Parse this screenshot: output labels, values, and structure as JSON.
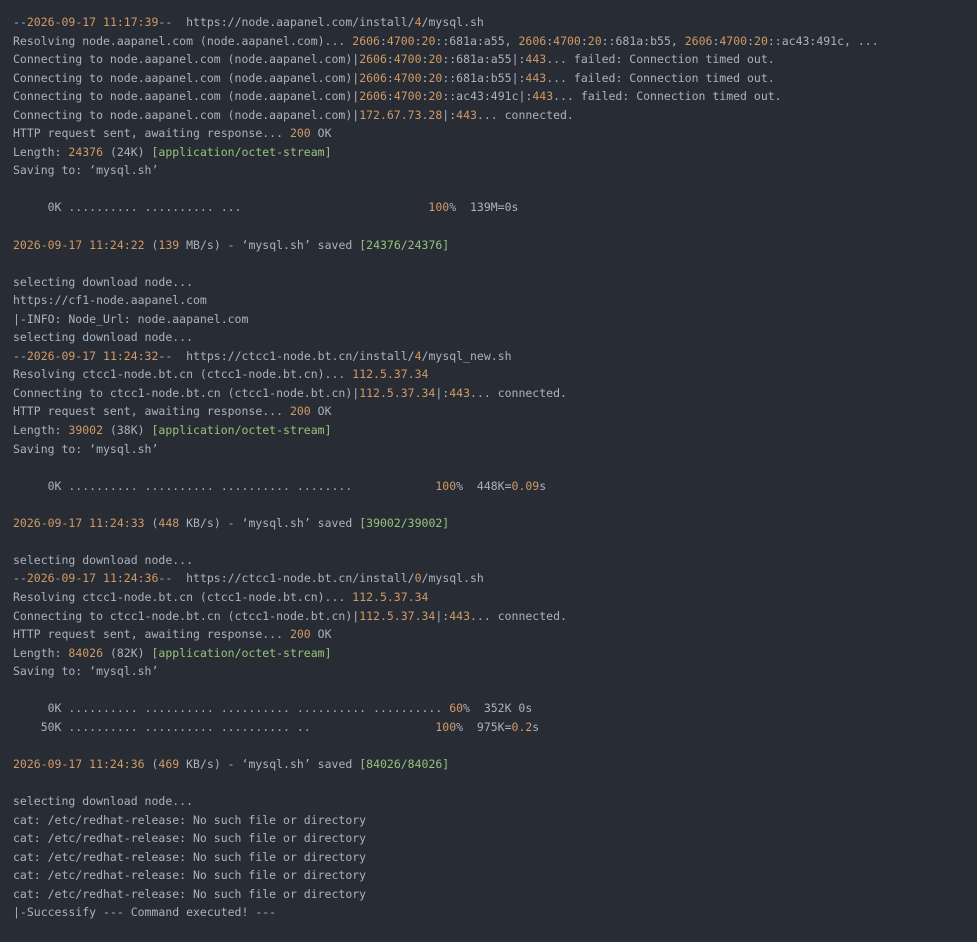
{
  "theme": {
    "background": "#282c34",
    "foreground": "#abb2bf",
    "number_color": "#d19a66",
    "string_color": "#98c379"
  },
  "terminal": {
    "lines": [
      [
        {
          "t": "--",
          "c": "d"
        },
        {
          "t": "2026-09-17 11:17:39",
          "c": "o"
        },
        {
          "t": "--  https://node.aapanel.com/install/",
          "c": "d"
        },
        {
          "t": "4",
          "c": "o"
        },
        {
          "t": "/mysql.sh",
          "c": "d"
        }
      ],
      [
        {
          "t": "Resolving node.aapanel.com (node.aapanel.com)... ",
          "c": "d"
        },
        {
          "t": "2606",
          "c": "o"
        },
        {
          "t": ":",
          "c": "d"
        },
        {
          "t": "4700",
          "c": "o"
        },
        {
          "t": ":",
          "c": "d"
        },
        {
          "t": "20",
          "c": "o"
        },
        {
          "t": "::681a:a55, ",
          "c": "d"
        },
        {
          "t": "2606",
          "c": "o"
        },
        {
          "t": ":",
          "c": "d"
        },
        {
          "t": "4700",
          "c": "o"
        },
        {
          "t": ":",
          "c": "d"
        },
        {
          "t": "20",
          "c": "o"
        },
        {
          "t": "::681a:b55, ",
          "c": "d"
        },
        {
          "t": "2606",
          "c": "o"
        },
        {
          "t": ":",
          "c": "d"
        },
        {
          "t": "4700",
          "c": "o"
        },
        {
          "t": ":",
          "c": "d"
        },
        {
          "t": "20",
          "c": "o"
        },
        {
          "t": "::ac43:491c, ...",
          "c": "d"
        }
      ],
      [
        {
          "t": "Connecting to node.aapanel.com (node.aapanel.com)|",
          "c": "d"
        },
        {
          "t": "2606",
          "c": "o"
        },
        {
          "t": ":",
          "c": "d"
        },
        {
          "t": "4700",
          "c": "o"
        },
        {
          "t": ":",
          "c": "d"
        },
        {
          "t": "20",
          "c": "o"
        },
        {
          "t": "::681a:a55|:",
          "c": "d"
        },
        {
          "t": "443",
          "c": "o"
        },
        {
          "t": "... failed: Connection timed out.",
          "c": "d"
        }
      ],
      [
        {
          "t": "Connecting to node.aapanel.com (node.aapanel.com)|",
          "c": "d"
        },
        {
          "t": "2606",
          "c": "o"
        },
        {
          "t": ":",
          "c": "d"
        },
        {
          "t": "4700",
          "c": "o"
        },
        {
          "t": ":",
          "c": "d"
        },
        {
          "t": "20",
          "c": "o"
        },
        {
          "t": "::681a:b55|:",
          "c": "d"
        },
        {
          "t": "443",
          "c": "o"
        },
        {
          "t": "... failed: Connection timed out.",
          "c": "d"
        }
      ],
      [
        {
          "t": "Connecting to node.aapanel.com (node.aapanel.com)|",
          "c": "d"
        },
        {
          "t": "2606",
          "c": "o"
        },
        {
          "t": ":",
          "c": "d"
        },
        {
          "t": "4700",
          "c": "o"
        },
        {
          "t": ":",
          "c": "d"
        },
        {
          "t": "20",
          "c": "o"
        },
        {
          "t": "::ac43:491c|:",
          "c": "d"
        },
        {
          "t": "443",
          "c": "o"
        },
        {
          "t": "... failed: Connection timed out.",
          "c": "d"
        }
      ],
      [
        {
          "t": "Connecting to node.aapanel.com (node.aapanel.com)|",
          "c": "d"
        },
        {
          "t": "172.67.73.28",
          "c": "o"
        },
        {
          "t": "|:",
          "c": "d"
        },
        {
          "t": "443",
          "c": "o"
        },
        {
          "t": "... connected.",
          "c": "d"
        }
      ],
      [
        {
          "t": "HTTP request sent, awaiting response... ",
          "c": "d"
        },
        {
          "t": "200",
          "c": "o"
        },
        {
          "t": " OK",
          "c": "d"
        }
      ],
      [
        {
          "t": "Length: ",
          "c": "d"
        },
        {
          "t": "24376",
          "c": "o"
        },
        {
          "t": " (24K) ",
          "c": "d"
        },
        {
          "t": "[application/octet-stream]",
          "c": "g"
        }
      ],
      [
        {
          "t": "Saving to: ‘mysql.sh’",
          "c": "d"
        }
      ],
      [],
      [
        {
          "t": "     0K .......... .......... ...                           ",
          "c": "d"
        },
        {
          "t": "100",
          "c": "o"
        },
        {
          "t": "%  139M=0s",
          "c": "d"
        }
      ],
      [],
      [
        {
          "t": "2026-09-17 11:24:22",
          "c": "o"
        },
        {
          "t": " (",
          "c": "d"
        },
        {
          "t": "139",
          "c": "o"
        },
        {
          "t": " MB/s) - ‘mysql.sh’ saved ",
          "c": "d"
        },
        {
          "t": "[24376/24376]",
          "c": "g"
        }
      ],
      [],
      [
        {
          "t": "selecting download node...",
          "c": "d"
        }
      ],
      [
        {
          "t": "https://cf1-node.aapanel.com",
          "c": "d"
        }
      ],
      [
        {
          "t": "|-INFO: Node_Url: node.aapanel.com",
          "c": "d"
        }
      ],
      [
        {
          "t": "selecting download node...",
          "c": "d"
        }
      ],
      [
        {
          "t": "--",
          "c": "d"
        },
        {
          "t": "2026-09-17 11:24:32",
          "c": "o"
        },
        {
          "t": "--  https://ctcc1-node.bt.cn/install/",
          "c": "d"
        },
        {
          "t": "4",
          "c": "o"
        },
        {
          "t": "/mysql_new.sh",
          "c": "d"
        }
      ],
      [
        {
          "t": "Resolving ctcc1-node.bt.cn (ctcc1-node.bt.cn)... ",
          "c": "d"
        },
        {
          "t": "112.5.37.34",
          "c": "o"
        }
      ],
      [
        {
          "t": "Connecting to ctcc1-node.bt.cn (ctcc1-node.bt.cn)|",
          "c": "d"
        },
        {
          "t": "112.5.37.34",
          "c": "o"
        },
        {
          "t": "|:",
          "c": "d"
        },
        {
          "t": "443",
          "c": "o"
        },
        {
          "t": "... connected.",
          "c": "d"
        }
      ],
      [
        {
          "t": "HTTP request sent, awaiting response... ",
          "c": "d"
        },
        {
          "t": "200",
          "c": "o"
        },
        {
          "t": " OK",
          "c": "d"
        }
      ],
      [
        {
          "t": "Length: ",
          "c": "d"
        },
        {
          "t": "39002",
          "c": "o"
        },
        {
          "t": " (38K) ",
          "c": "d"
        },
        {
          "t": "[application/octet-stream]",
          "c": "g"
        }
      ],
      [
        {
          "t": "Saving to: ‘mysql.sh’",
          "c": "d"
        }
      ],
      [],
      [
        {
          "t": "     0K .......... .......... .......... ........            ",
          "c": "d"
        },
        {
          "t": "100",
          "c": "o"
        },
        {
          "t": "%  448K=",
          "c": "d"
        },
        {
          "t": "0.09",
          "c": "o"
        },
        {
          "t": "s",
          "c": "d"
        }
      ],
      [],
      [
        {
          "t": "2026-09-17 11:24:33",
          "c": "o"
        },
        {
          "t": " (",
          "c": "d"
        },
        {
          "t": "448",
          "c": "o"
        },
        {
          "t": " KB/s) - ‘mysql.sh’ saved ",
          "c": "d"
        },
        {
          "t": "[39002/39002]",
          "c": "g"
        }
      ],
      [],
      [
        {
          "t": "selecting download node...",
          "c": "d"
        }
      ],
      [
        {
          "t": "--",
          "c": "d"
        },
        {
          "t": "2026-09-17 11:24:36",
          "c": "o"
        },
        {
          "t": "--  https://ctcc1-node.bt.cn/install/",
          "c": "d"
        },
        {
          "t": "0",
          "c": "o"
        },
        {
          "t": "/mysql.sh",
          "c": "d"
        }
      ],
      [
        {
          "t": "Resolving ctcc1-node.bt.cn (ctcc1-node.bt.cn)... ",
          "c": "d"
        },
        {
          "t": "112.5.37.34",
          "c": "o"
        }
      ],
      [
        {
          "t": "Connecting to ctcc1-node.bt.cn (ctcc1-node.bt.cn)|",
          "c": "d"
        },
        {
          "t": "112.5.37.34",
          "c": "o"
        },
        {
          "t": "|:",
          "c": "d"
        },
        {
          "t": "443",
          "c": "o"
        },
        {
          "t": "... connected.",
          "c": "d"
        }
      ],
      [
        {
          "t": "HTTP request sent, awaiting response... ",
          "c": "d"
        },
        {
          "t": "200",
          "c": "o"
        },
        {
          "t": " OK",
          "c": "d"
        }
      ],
      [
        {
          "t": "Length: ",
          "c": "d"
        },
        {
          "t": "84026",
          "c": "o"
        },
        {
          "t": " (82K) ",
          "c": "d"
        },
        {
          "t": "[application/octet-stream]",
          "c": "g"
        }
      ],
      [
        {
          "t": "Saving to: ‘mysql.sh’",
          "c": "d"
        }
      ],
      [],
      [
        {
          "t": "     0K .......... .......... .......... .......... .......... ",
          "c": "d"
        },
        {
          "t": "60",
          "c": "o"
        },
        {
          "t": "%  352K 0s",
          "c": "d"
        }
      ],
      [
        {
          "t": "    50K .......... .......... .......... ..                  ",
          "c": "d"
        },
        {
          "t": "100",
          "c": "o"
        },
        {
          "t": "%  975K=",
          "c": "d"
        },
        {
          "t": "0.2",
          "c": "o"
        },
        {
          "t": "s",
          "c": "d"
        }
      ],
      [],
      [
        {
          "t": "2026-09-17 11:24:36",
          "c": "o"
        },
        {
          "t": " (",
          "c": "d"
        },
        {
          "t": "469",
          "c": "o"
        },
        {
          "t": " KB/s) - ‘mysql.sh’ saved ",
          "c": "d"
        },
        {
          "t": "[84026/84026]",
          "c": "g"
        }
      ],
      [],
      [
        {
          "t": "selecting download node...",
          "c": "d"
        }
      ],
      [
        {
          "t": "cat: /etc/redhat-release: No such file or directory",
          "c": "d"
        }
      ],
      [
        {
          "t": "cat: /etc/redhat-release: No such file or directory",
          "c": "d"
        }
      ],
      [
        {
          "t": "cat: /etc/redhat-release: No such file or directory",
          "c": "d"
        }
      ],
      [
        {
          "t": "cat: /etc/redhat-release: No such file or directory",
          "c": "d"
        }
      ],
      [
        {
          "t": "cat: /etc/redhat-release: No such file or directory",
          "c": "d"
        }
      ],
      [
        {
          "t": "|-Successify --- Command executed! ---",
          "c": "d"
        }
      ]
    ]
  }
}
